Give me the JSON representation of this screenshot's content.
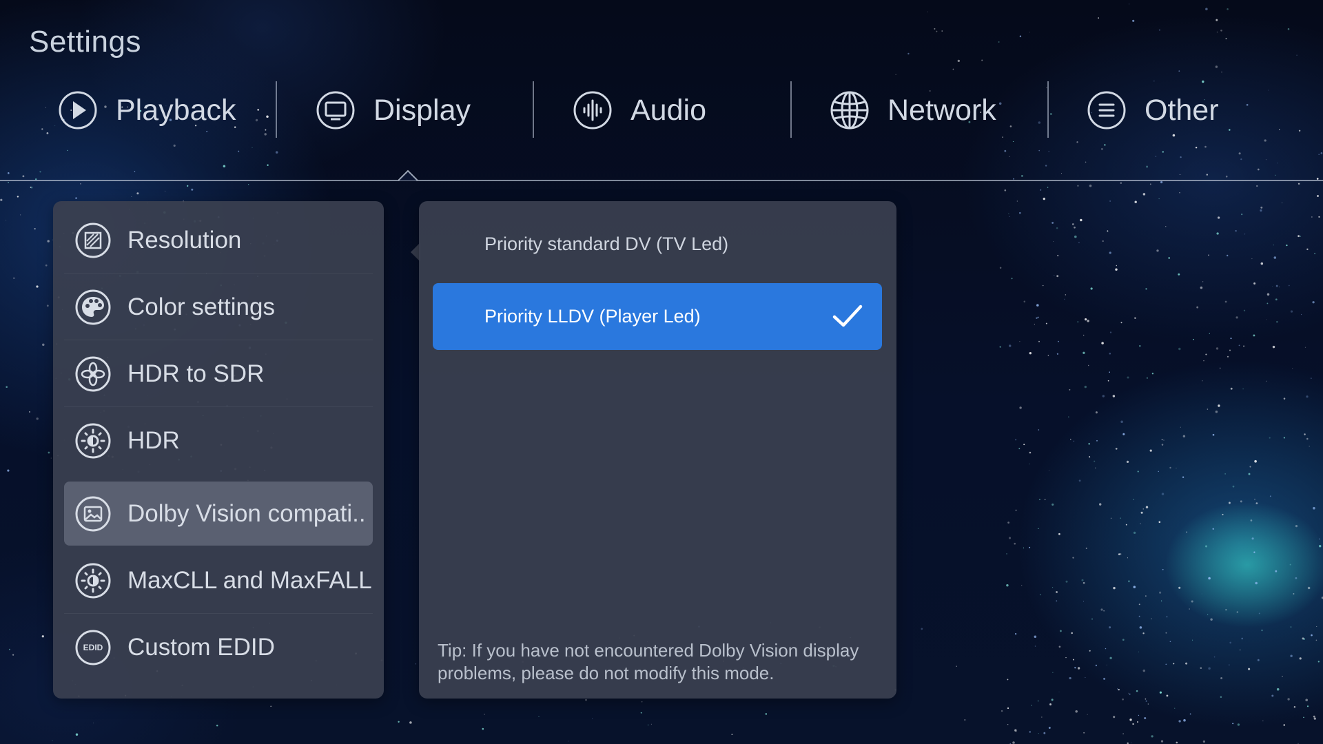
{
  "page": {
    "title": "Settings"
  },
  "tabs": [
    {
      "label": "Playback",
      "icon": "play-circle-icon"
    },
    {
      "label": "Display",
      "icon": "monitor-icon"
    },
    {
      "label": "Audio",
      "icon": "audio-wave-icon"
    },
    {
      "label": "Network",
      "icon": "globe-icon"
    },
    {
      "label": "Other",
      "icon": "menu-lines-icon"
    }
  ],
  "active_tab": "Display",
  "menu": {
    "items": [
      {
        "label": "Resolution",
        "icon": "resolution-icon"
      },
      {
        "label": "Color settings",
        "icon": "palette-icon"
      },
      {
        "label": "HDR to SDR",
        "icon": "aperture-icon"
      },
      {
        "label": "HDR",
        "icon": "hdr-sun-icon"
      },
      {
        "label": "Dolby Vision compati..",
        "icon": "image-icon"
      },
      {
        "label": "MaxCLL and MaxFALL",
        "icon": "brightness-icon"
      },
      {
        "label": "Custom EDID",
        "icon": "edid-icon",
        "badge": "EDID"
      }
    ],
    "selected": "Dolby Vision compati.."
  },
  "options": {
    "items": [
      {
        "label": "Priority standard DV (TV Led)",
        "selected": false
      },
      {
        "label": "Priority LLDV (Player Led)",
        "selected": true
      }
    ],
    "tip": "Tip: If you have not encountered Dolby Vision display problems, please do not modify this mode."
  },
  "colors": {
    "accent": "#2a78de",
    "card": "#3a3f50",
    "selected_menu": "#787e90",
    "background": "#050b1d"
  }
}
